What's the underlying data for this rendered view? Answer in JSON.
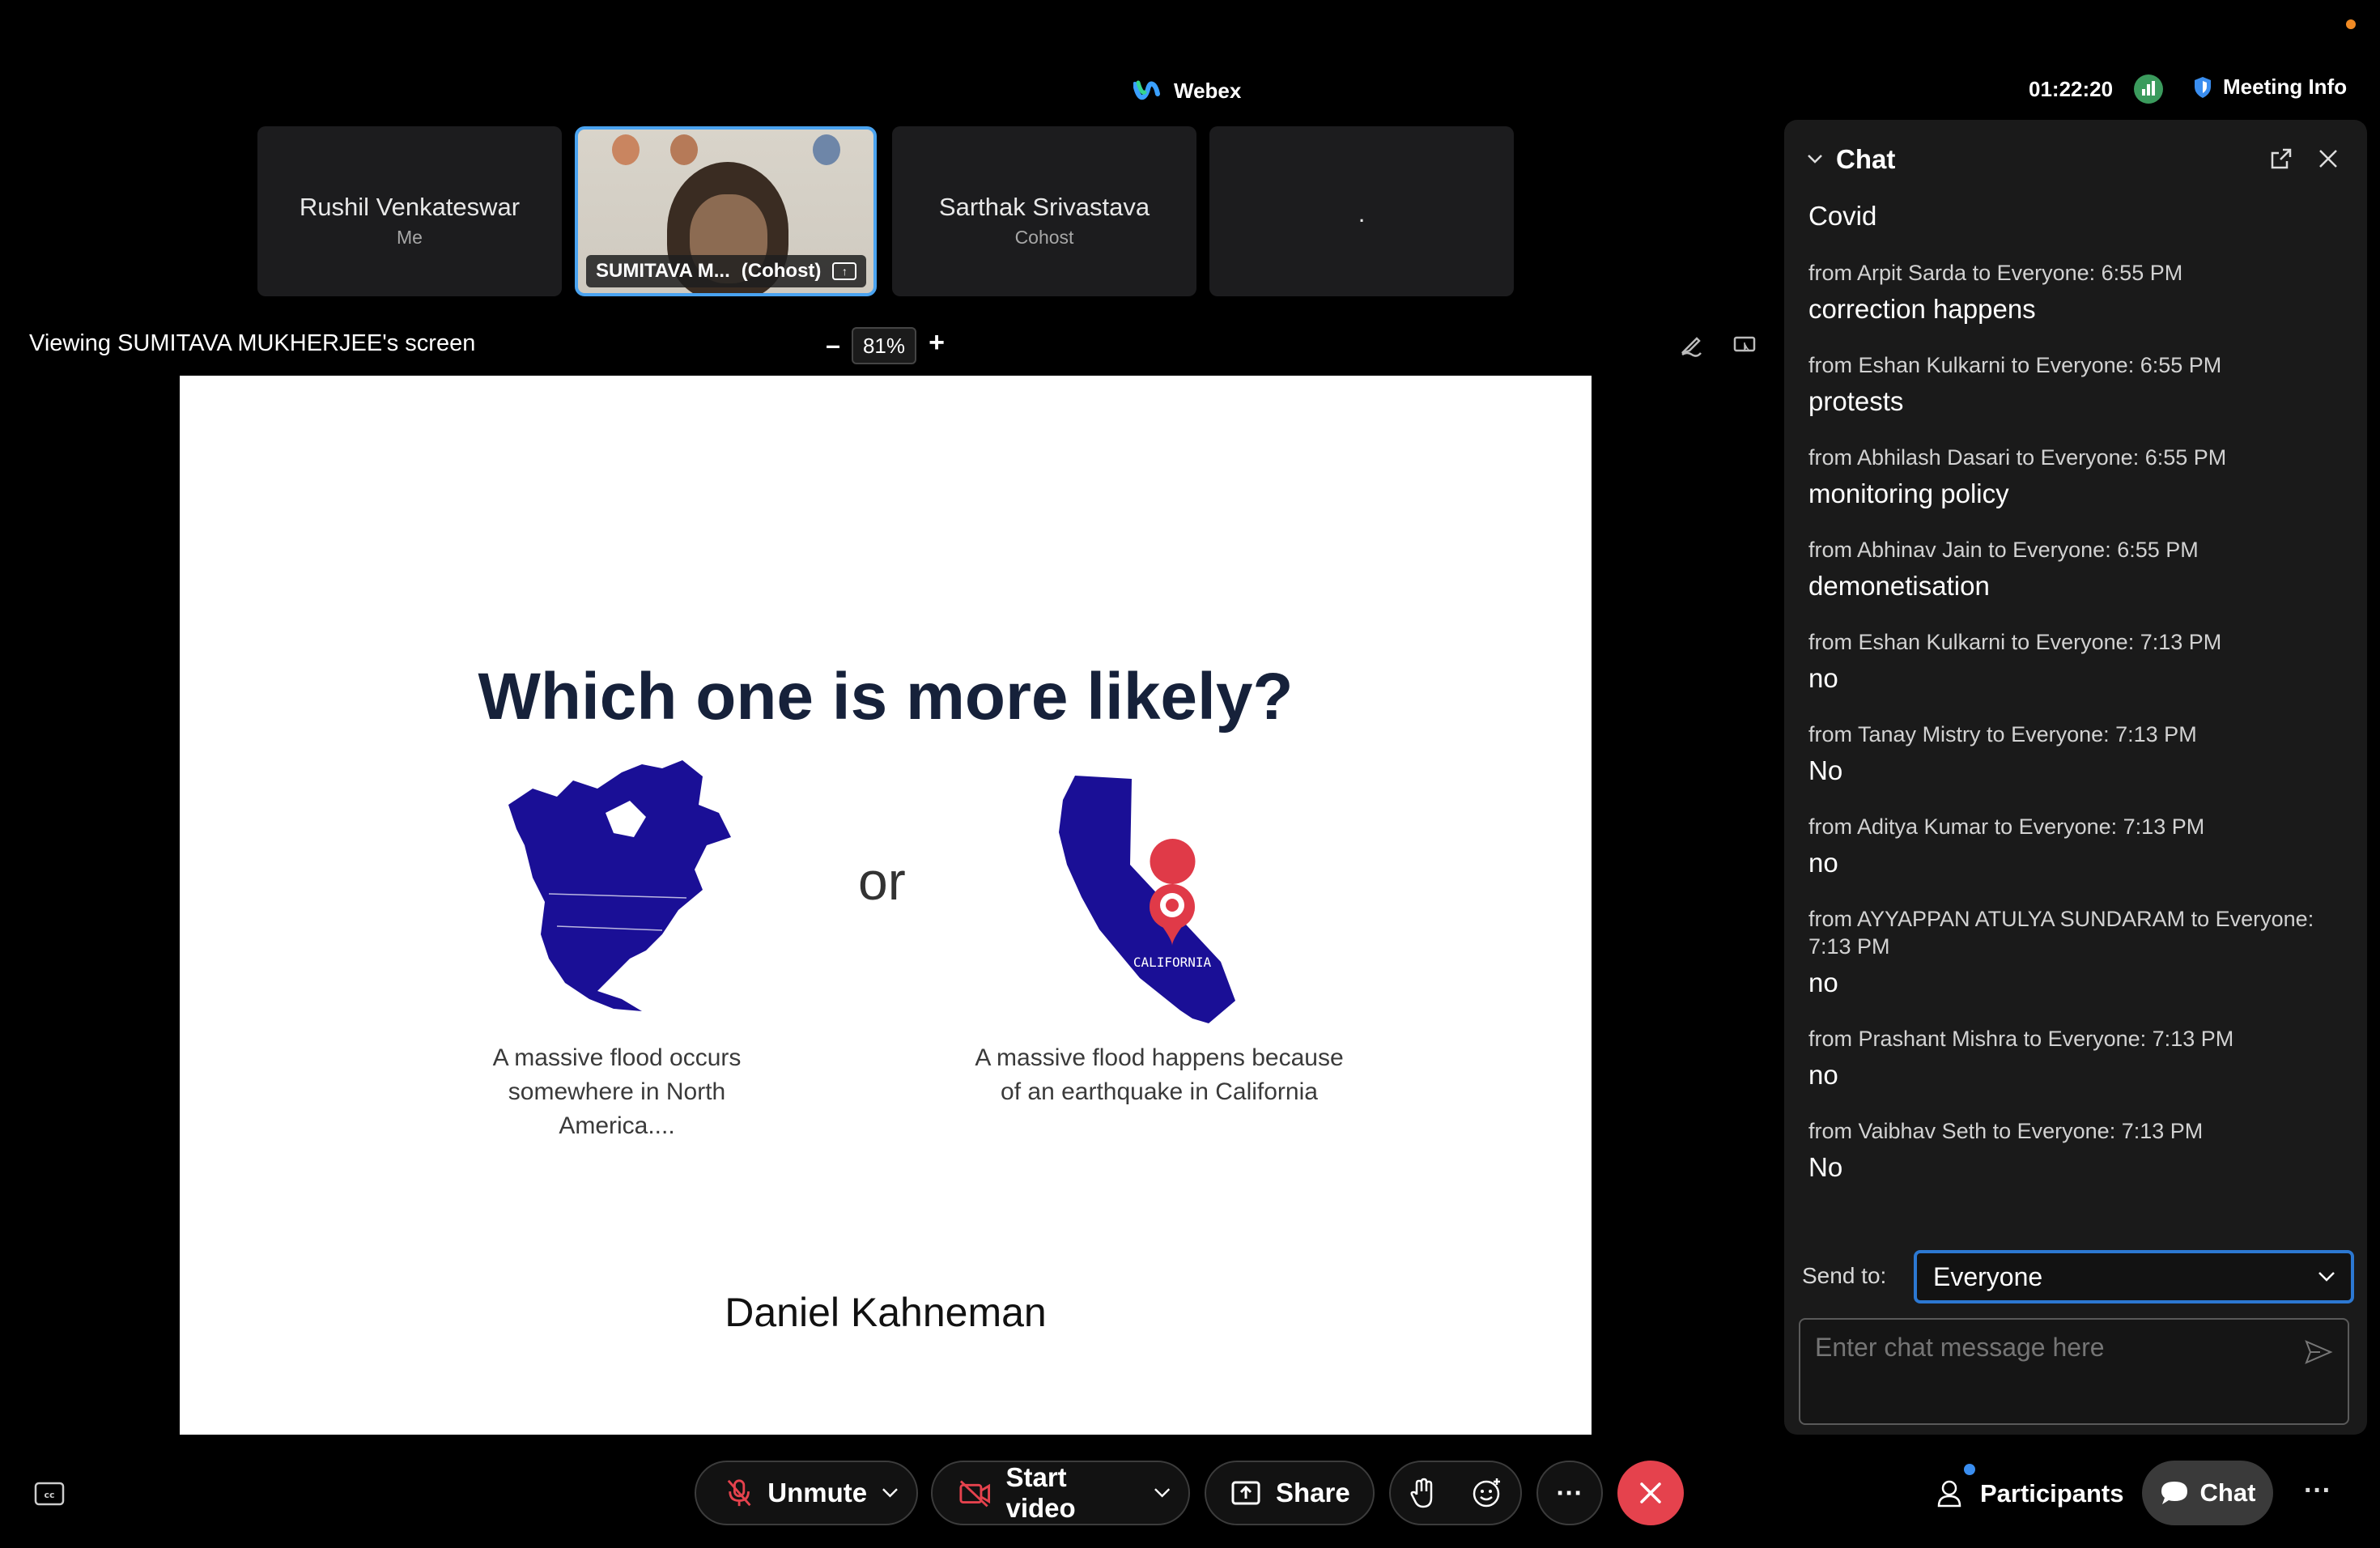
{
  "topbar": {
    "app_name": "Webex",
    "timer": "01:22:20",
    "meeting_info_label": "Meeting Info"
  },
  "participants_strip": [
    {
      "name": "Rushil Venkateswar",
      "role": "Me"
    },
    {
      "name": "SUMITAVA M...",
      "role": "(Cohost)"
    },
    {
      "name": "Sarthak Srivastava",
      "role": "Cohost"
    },
    {
      "name": ".",
      "role": ""
    }
  ],
  "share_view": {
    "viewing_label": "Viewing SUMITAVA MUKHERJEE's screen",
    "zoom_value": "81%",
    "zoom_minus": "–",
    "zoom_plus": "+"
  },
  "slide": {
    "title": "Which one is more likely?",
    "or_text": "or",
    "map_label": "CALIFORNIA",
    "caption_left": "A massive flood occurs somewhere in North America....",
    "caption_right": "A massive flood happens because of an earthquake in California",
    "author": "Daniel Kahneman"
  },
  "chat": {
    "title": "Chat",
    "first_message": "Covid",
    "messages": [
      {
        "meta": "from Arpit Sarda to Everyone:   6:55  PM",
        "text": "correction happens"
      },
      {
        "meta": "from Eshan Kulkarni to Everyone:   6:55  PM",
        "text": "protests"
      },
      {
        "meta": "from Abhilash Dasari to Everyone:   6:55  PM",
        "text": "monitoring policy"
      },
      {
        "meta": "from Abhinav Jain to Everyone:   6:55  PM",
        "text": "demonetisation"
      },
      {
        "meta": "from Eshan Kulkarni to Everyone:   7:13  PM",
        "text": "no"
      },
      {
        "meta": "from Tanay Mistry to Everyone:   7:13  PM",
        "text": "No"
      },
      {
        "meta": "from Aditya Kumar to Everyone:   7:13  PM",
        "text": "no"
      },
      {
        "meta": "from AYYAPPAN ATULYA SUNDARAM to Everyone: 7:13  PM",
        "text": "no"
      },
      {
        "meta": "from Prashant Mishra to Everyone:   7:13  PM",
        "text": "no"
      },
      {
        "meta": "from Vaibhav Seth to Everyone:   7:13  PM",
        "text": "No"
      }
    ],
    "send_to_label": "Send to:",
    "send_to_value": "Everyone",
    "input_placeholder": "Enter chat message here"
  },
  "controls": {
    "unmute_label": "Unmute",
    "start_video_label": "Start video",
    "share_label": "Share",
    "more_label": "···",
    "participants_label": "Participants",
    "chat_label": "Chat",
    "overflow_label": "···"
  },
  "colors": {
    "accent_blue": "#2c78d2",
    "end_call_red": "#e5424d",
    "map_blue": "#1a0f96",
    "pin_red": "#e03a48"
  },
  "icons": [
    "webex-logo-icon",
    "network-icon",
    "shield-icon",
    "share-screen-icon",
    "annotate-icon",
    "remote-control-icon",
    "chevron-down-icon",
    "popout-icon",
    "close-icon",
    "send-icon",
    "closed-captions-icon",
    "mic-muted-icon",
    "video-off-icon",
    "share-icon",
    "raise-hand-icon",
    "reactions-icon",
    "end-call-icon",
    "participants-icon",
    "chat-bubble-icon"
  ]
}
